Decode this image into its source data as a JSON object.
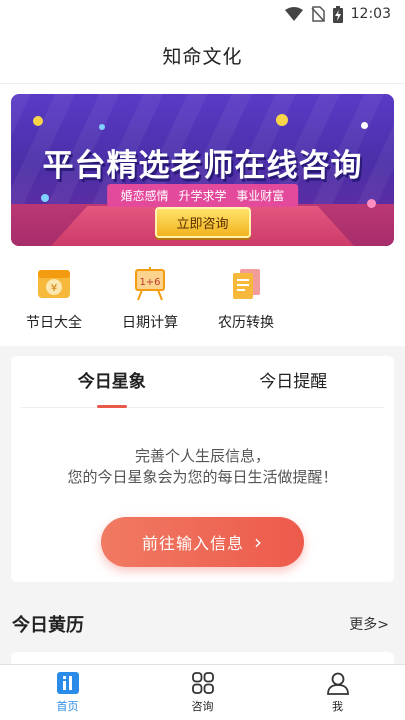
{
  "status_bar": {
    "time": "12:03",
    "icons": [
      "wifi-icon",
      "no-sim-icon",
      "battery-charging-icon"
    ]
  },
  "header": {
    "title": "知命文化"
  },
  "banner": {
    "title": "平台精选老师在线咨询",
    "tags": "婚恋感情  升学求学  事业财富",
    "button_label": "立即咨询",
    "colors": {
      "background": "#5a3bc6",
      "floor": "#c63f7a",
      "tags": "#e44a9b",
      "button": "#f2b31e"
    }
  },
  "quick_actions": [
    {
      "label": "节日大全",
      "icon": "festival-coin-icon"
    },
    {
      "label": "日期计算",
      "icon": "date-calc-easel-icon"
    },
    {
      "label": "农历转换",
      "icon": "lunar-convert-doc-icon"
    }
  ],
  "today_card": {
    "tabs": [
      {
        "label": "今日星象",
        "active": true
      },
      {
        "label": "今日提醒",
        "active": false
      }
    ],
    "message_line1": "完善个人生辰信息，",
    "message_line2": "您的今日星象会为您的每日生活做提醒！",
    "cta_label": "前往输入信息",
    "cta_arrow": "›",
    "accent": "#ed5a4c"
  },
  "almanac": {
    "title": "今日黄历",
    "more_label": "更多>"
  },
  "bottom_nav": [
    {
      "label": "首页",
      "icon": "home-icon",
      "active": true
    },
    {
      "label": "咨询",
      "icon": "grid-icon",
      "active": false
    },
    {
      "label": "我",
      "icon": "profile-icon",
      "active": false
    }
  ],
  "colors": {
    "nav_active": "#2a8be8"
  }
}
